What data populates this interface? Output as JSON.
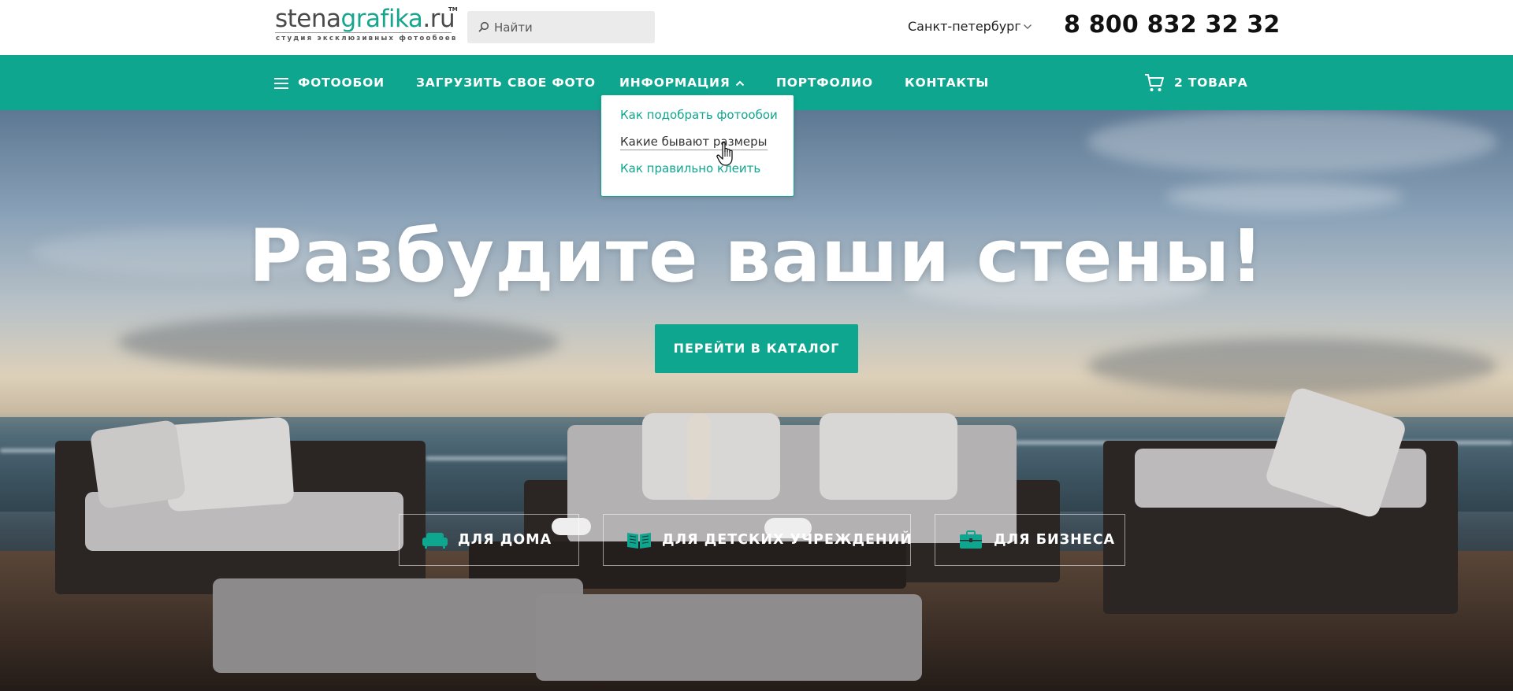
{
  "header": {
    "logo": {
      "part1": "stena",
      "part2": "grafika",
      "part3": ".ru",
      "tm": "TM",
      "tagline": "студия эксклюзивных фотообоев"
    },
    "search": {
      "placeholder": "Найти",
      "icon": "search-icon"
    },
    "city": "Санкт-петербург",
    "phone": "8 800 832 32 32"
  },
  "nav": {
    "items": [
      {
        "label": "ФОТООБОИ",
        "icon": "menu-icon"
      },
      {
        "label": "ЗАГРУЗИТЬ СВОЕ ФОТО"
      },
      {
        "label": "ИНФОРМАЦИЯ",
        "icon": "chevron-up-icon"
      },
      {
        "label": "ПОРТФОЛИО"
      },
      {
        "label": "КОНТАКТЫ"
      }
    ],
    "cart": {
      "label": "2 ТОВАРА",
      "icon": "cart-icon"
    }
  },
  "dropdown": {
    "items": [
      {
        "label": "Как подобрать фотообои"
      },
      {
        "label": "Какие бывают размеры"
      },
      {
        "label": "Как правильно клеить"
      }
    ]
  },
  "hero": {
    "headline": "Разбудите ваши стены!",
    "cta": "ПЕРЕЙТИ В КАТАЛОГ",
    "categories": [
      {
        "label": "ДЛЯ ДОМА",
        "icon": "sofa-icon"
      },
      {
        "label": "ДЛЯ ДЕТСКИХ УЧРЕЖДЕНИЙ",
        "icon": "book-icon"
      },
      {
        "label": "ДЛЯ БИЗНЕСА",
        "icon": "briefcase-icon"
      }
    ]
  },
  "colors": {
    "accent": "#0ea68e",
    "text": "#222222"
  }
}
